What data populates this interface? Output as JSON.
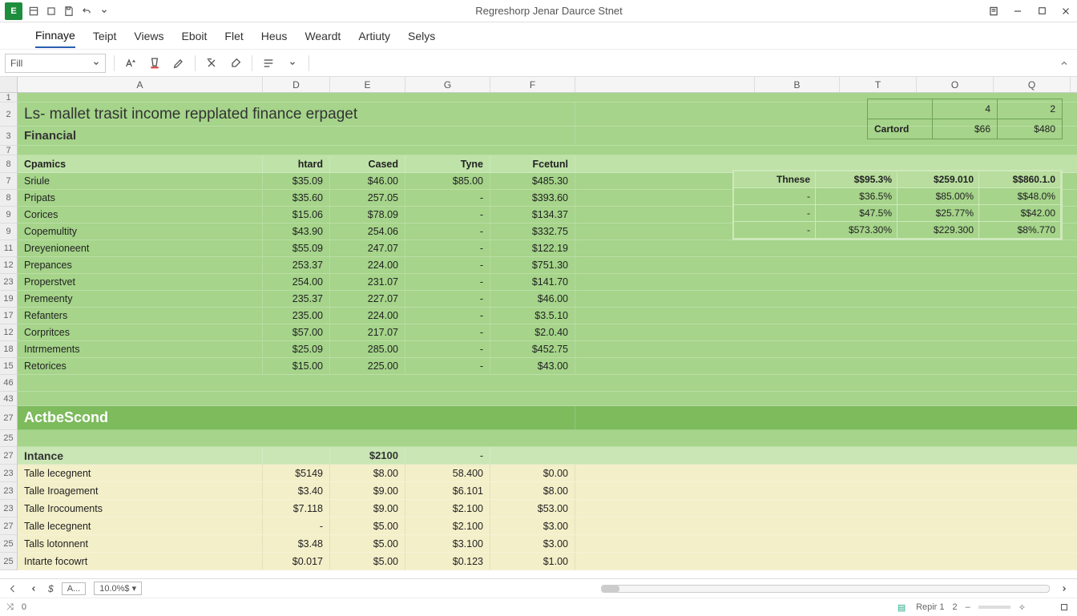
{
  "title": "Regreshorp Jenar Daurce Stnet",
  "app_initial": "E",
  "menus": [
    "Finnaye",
    "Teipt",
    "Views",
    "Eboit",
    "Flet",
    "Heus",
    "Weardt",
    "Artiuty",
    "Selys"
  ],
  "active_menu": 0,
  "fill_label": "Fill",
  "col_headers": {
    "A": "A",
    "D": "D",
    "E": "E",
    "G": "G",
    "F": "F",
    "B": "B",
    "T": "T",
    "O": "O",
    "Q": "Q"
  },
  "row_nums": [
    "1",
    "2",
    "3",
    "7",
    "8",
    "7",
    "8",
    "9",
    "9",
    "11",
    "12",
    "23",
    "19",
    "17",
    "12",
    "18",
    "15",
    "46",
    "43",
    "27",
    "25",
    "27",
    "23",
    "23",
    "23",
    "27",
    "25",
    "25"
  ],
  "sheet": {
    "title": "Ls- mallet trasit income repplated finance erpaget",
    "section1": "Financial",
    "headers": {
      "c1": "Cpamics",
      "c2": "htard",
      "c3": "Cased",
      "c4": "Tyne",
      "c5": "Fcetunl"
    },
    "rows": [
      {
        "a": "Sriule",
        "d": "$35.09",
        "e": "$46.00",
        "g": "$85.00",
        "f": "$485.30"
      },
      {
        "a": "Pripats",
        "d": "$35.60",
        "e": "257.05",
        "g": "-",
        "f": "$393.60"
      },
      {
        "a": "Corices",
        "d": "$15.06",
        "e": "$78.09",
        "g": "-",
        "f": "$134.37"
      },
      {
        "a": "Copemultity",
        "d": "$43.90",
        "e": "254.06",
        "g": "-",
        "f": "$332.75"
      },
      {
        "a": "Dreyenioneent",
        "d": "$55.09",
        "e": "247.07",
        "g": "-",
        "f": "$122.19"
      },
      {
        "a": "Prepances",
        "d": "253.37",
        "e": "224.00",
        "g": "-",
        "f": "$751.30"
      },
      {
        "a": "Properstvet",
        "d": "254.00",
        "e": "231.07",
        "g": "-",
        "f": "$141.70"
      },
      {
        "a": "Premeenty",
        "d": "235.37",
        "e": "227.07",
        "g": "-",
        "f": "$46.00"
      },
      {
        "a": "Refanters",
        "d": "235.00",
        "e": "224.00",
        "g": "-",
        "f": "$3.5.10"
      },
      {
        "a": "Corpritces",
        "d": "$57.00",
        "e": "217.07",
        "g": "-",
        "f": "$2.0.40"
      },
      {
        "a": "Intrmements",
        "d": "$25.09",
        "e": "285.00",
        "g": "-",
        "f": "$452.75"
      },
      {
        "a": "Retorices",
        "d": "$15.00",
        "e": "225.00",
        "g": "-",
        "f": "$43.00"
      }
    ],
    "section2": "ActbeScond",
    "intance": {
      "label": "Intance",
      "val1": "$2100",
      "val2": "-"
    },
    "rows2": [
      {
        "a": "Talle lecegnent",
        "d": "$5149",
        "e": "$8.00",
        "g": "58.400",
        "f": "$0.00"
      },
      {
        "a": "Talle Iroagement",
        "d": "$3.40",
        "e": "$9.00",
        "g": "$6.101",
        "f": "$8.00"
      },
      {
        "a": "Talle Irocouments",
        "d": "$7.118",
        "e": "$9.00",
        "g": "$2.100",
        "f": "$53.00"
      },
      {
        "a": "Talle lecegnent",
        "d": "-",
        "e": "$5.00",
        "g": "$2.100",
        "f": "$3.00"
      },
      {
        "a": "Talls lotonnent",
        "d": "$3.48",
        "e": "$5.00",
        "g": "$3.100",
        "f": "$3.00"
      },
      {
        "a": "Intarte focowrt",
        "d": "$0.017",
        "e": "$5.00",
        "g": "$0.123",
        "f": "$1.00"
      }
    ]
  },
  "cartord": {
    "top": {
      "a": "",
      "b": "4",
      "c": "2"
    },
    "row": {
      "a": "Cartord",
      "b": "$66",
      "c": "$480"
    }
  },
  "thnese": {
    "head": {
      "a": "Thnese",
      "b": "$$95.3%",
      "c": "$259.010",
      "d": "$$860.1.0"
    },
    "rows": [
      {
        "a": "-",
        "b": "$36.5%",
        "c": "$85.00%",
        "d": "$$48.0%"
      },
      {
        "a": "-",
        "b": "$47.5%",
        "c": "$25.77%",
        "d": "$$42.00"
      },
      {
        "a": "-",
        "b": "$573.30%",
        "c": "$229.300",
        "d": "$8%.770"
      }
    ]
  },
  "status": {
    "cellref": "A...",
    "zoom": "10.0%$ ▾",
    "repir": "Repir 1",
    "page": "2",
    "leftnum": "0"
  },
  "widths": {
    "A": 306,
    "D": 84,
    "E": 94,
    "G": 106,
    "F": 106,
    "gap": 224,
    "B": 106,
    "T": 96,
    "O": 96,
    "Q": 96
  }
}
